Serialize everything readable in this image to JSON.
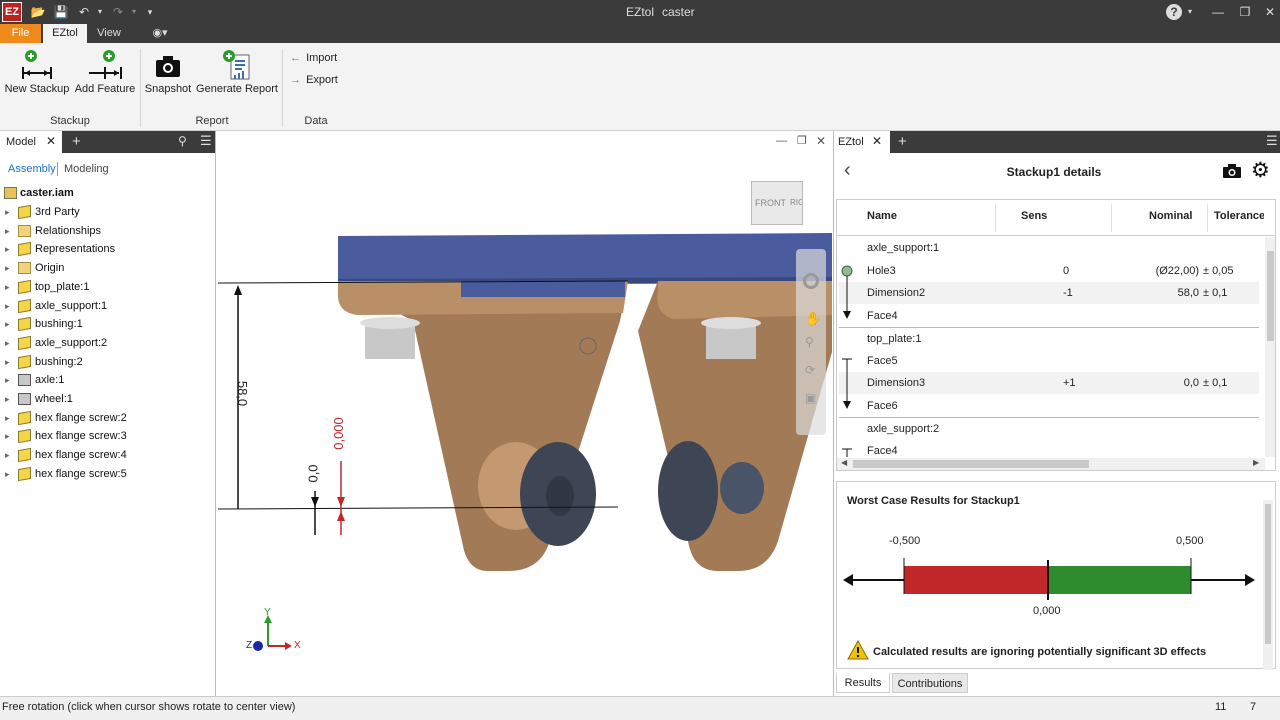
{
  "app": {
    "name": "EZtol",
    "document": "caster"
  },
  "menu": {
    "file": "File",
    "eztol": "EZtol",
    "view": "View"
  },
  "ribbon": {
    "new_stackup": "New Stackup",
    "add_feature": "Add Feature",
    "snapshot": "Snapshot",
    "generate_report": "Generate Report",
    "import": "Import",
    "export": "Export",
    "groups": {
      "stackup": "Stackup",
      "report": "Report",
      "data": "Data"
    }
  },
  "left_panel": {
    "tab": "Model",
    "subtabs": {
      "assembly": "Assembly",
      "modeling": "Modeling"
    },
    "root": "caster.iam",
    "items": [
      {
        "label": "3rd Party"
      },
      {
        "label": "Relationships"
      },
      {
        "label": "Representations"
      },
      {
        "label": "Origin"
      },
      {
        "label": "top_plate:1"
      },
      {
        "label": "axle_support:1"
      },
      {
        "label": "bushing:1"
      },
      {
        "label": "axle_support:2"
      },
      {
        "label": "bushing:2"
      },
      {
        "label": "axle:1"
      },
      {
        "label": "wheel:1"
      },
      {
        "label": "hex flange screw:2"
      },
      {
        "label": "hex flange screw:3"
      },
      {
        "label": "hex flange screw:4"
      },
      {
        "label": "hex flange screw:5"
      }
    ]
  },
  "viewport": {
    "viewcube": {
      "front": "FRONT",
      "right": "RIGHT"
    },
    "dim_58": "58,0",
    "dim_0": "0,0",
    "dim_000": "0,000",
    "axes": {
      "x": "X",
      "y": "Y",
      "z": "Z"
    }
  },
  "right_panel": {
    "tab": "EZtol",
    "title": "Stackup1 details",
    "columns": {
      "name": "Name",
      "sens": "Sens",
      "nominal": "Nominal",
      "tolerance": "Tolerance"
    },
    "rows": [
      {
        "name": "axle_support:1",
        "sens": "",
        "nominal": "",
        "tol": ""
      },
      {
        "name": "Hole3",
        "sens": "0",
        "nominal": "(Ø22,00)",
        "tol": "± 0,05"
      },
      {
        "name": "Dimension2",
        "sens": "-1",
        "nominal": "58,0",
        "tol": "± 0,1"
      },
      {
        "name": "Face4",
        "sens": "",
        "nominal": "",
        "tol": ""
      },
      {
        "name": "top_plate:1",
        "sens": "",
        "nominal": "",
        "tol": ""
      },
      {
        "name": "Face5",
        "sens": "",
        "nominal": "",
        "tol": ""
      },
      {
        "name": "Dimension3",
        "sens": "+1",
        "nominal": "0,0",
        "tol": "± 0,1"
      },
      {
        "name": "Face6",
        "sens": "",
        "nominal": "",
        "tol": ""
      },
      {
        "name": "axle_support:2",
        "sens": "",
        "nominal": "",
        "tol": ""
      },
      {
        "name": "Face4",
        "sens": "",
        "nominal": "",
        "tol": ""
      }
    ],
    "results": {
      "title": "Worst Case Results for Stackup1",
      "min": "-0,500",
      "max": "0,500",
      "nominal": "0,000",
      "warning": "Calculated results are ignoring potentially significant 3D effects"
    },
    "bottom_tabs": {
      "results": "Results",
      "contributions": "Contributions"
    }
  },
  "status": {
    "text": "Free rotation (click when cursor shows rotate to center view)",
    "n1": "11",
    "n2": "7"
  },
  "colors": {
    "accent": "#f08a1c",
    "plate": "#4a5b9e",
    "support": "#a27a55",
    "wheel": "#3e4656",
    "red": "#c0282a",
    "green": "#2e8b2e"
  }
}
